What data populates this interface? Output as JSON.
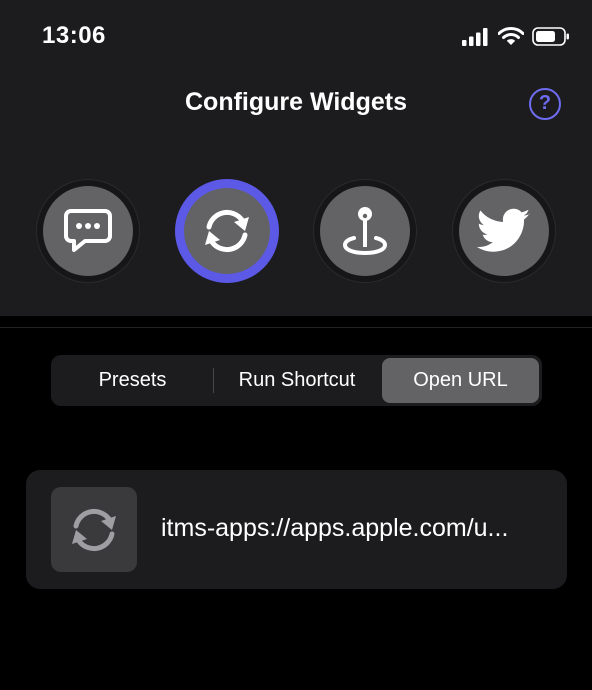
{
  "status": {
    "time": "13:06"
  },
  "header": {
    "title": "Configure Widgets",
    "help_label": "?"
  },
  "widgets": [
    {
      "icon": "message-bubble-icon",
      "selected": false
    },
    {
      "icon": "refresh-icon",
      "selected": true
    },
    {
      "icon": "joystick-icon",
      "selected": false
    },
    {
      "icon": "twitter-bird-icon",
      "selected": false
    }
  ],
  "segments": {
    "items": [
      "Presets",
      "Run Shortcut",
      "Open URL"
    ],
    "selected": "Open URL"
  },
  "url_row": {
    "icon": "refresh-icon",
    "url": "itms-apps://apps.apple.com/u..."
  },
  "colors": {
    "accent": "#5b59e6",
    "background": "#000000",
    "panel": "#1c1c1e",
    "icon_fill": "#636366"
  }
}
